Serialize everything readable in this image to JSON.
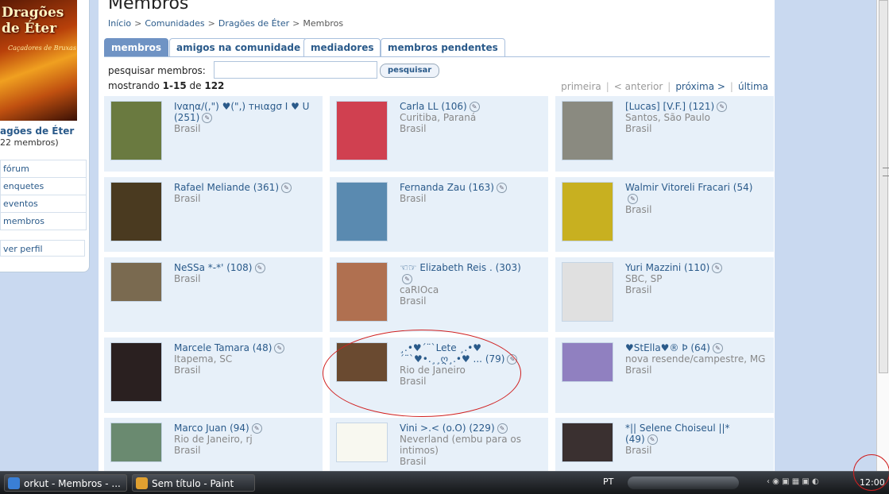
{
  "sidebar": {
    "community_name": "agões de Éter",
    "member_count": "22 membros)",
    "image_title": "Dragões de Éter",
    "image_subtitle": "Caçadores de Bruxas",
    "menu": [
      "fórum",
      "enquetes",
      "eventos",
      "membros"
    ],
    "profile_link": "ver perfil"
  },
  "page": {
    "title": "Membros",
    "breadcrumb": [
      "Início",
      "Comunidades",
      "Dragões de Éter",
      "Membros"
    ]
  },
  "tabs": [
    "membros",
    "amigos na comunidade",
    "mediadores",
    "membros pendentes"
  ],
  "search": {
    "label": "pesquisar membros:",
    "value": "",
    "button": "pesquisar"
  },
  "showing": {
    "prefix": "mostrando",
    "range": "1-15",
    "of": "de",
    "total": "122"
  },
  "pager": {
    "first": "primeira",
    "prev": "< anterior",
    "next": "próxima >",
    "last": "última"
  },
  "members": [
    {
      "name": "Ιvαηα/(,\") ♥(\",) тнιαgσ I ♥ U",
      "count": "(251)",
      "city": "",
      "country": "Brasil",
      "photo": "#6a7a40"
    },
    {
      "name": "Carla LL",
      "count": "(106)",
      "city": "Curitiba, Paraná",
      "country": "Brasil",
      "photo": "#d04050"
    },
    {
      "name": "[Lucas] [V.F.]",
      "count": "(121)",
      "city": "Santos, São Paulo",
      "country": "Brasil",
      "photo": "#8a8a80"
    },
    {
      "name": "Rafael Meliande",
      "count": "(361)",
      "city": "",
      "country": "Brasil",
      "photo": "#4a3a20"
    },
    {
      "name": "Fernanda Zau",
      "count": "(163)",
      "city": "",
      "country": "Brasil",
      "photo": "#5a8ab0"
    },
    {
      "name": "Walmir Vitoreli Fracari",
      "count": "(54)",
      "city": "",
      "country": "Brasil",
      "photo": "#c8b020"
    },
    {
      "name": "NeSSa *-*'",
      "count": "(108)",
      "city": "",
      "country": "Brasil",
      "photo": "#7a6a50"
    },
    {
      "name": "☜☞ Elizabeth Reis .",
      "count": "(303)",
      "city": "caRIOca",
      "country": "Brasil",
      "photo": "#b07050"
    },
    {
      "name": "Yuri Mazzini",
      "count": "(110)",
      "city": "SBC, SP",
      "country": "Brasil",
      "photo": "#e0e0e0"
    },
    {
      "name": "Marcele Tamara",
      "count": "(48)",
      "city": "Itapema, SC",
      "country": "Brasil",
      "photo": "#2a2020"
    },
    {
      "name": "¸.•♥´¨`Lete ¸.•♥´¨`♥•.¸¸ღ¸.•♥ ...",
      "count": "(79)",
      "city": "Rio de Janeiro",
      "country": "Brasil",
      "photo": "#6a4a30"
    },
    {
      "name": "♥StElla♥® Þ",
      "count": "(64)",
      "city": "nova resende/campestre, MG",
      "country": "Brasil",
      "photo": "#9080c0"
    },
    {
      "name": "Marco Juan",
      "count": "(94)",
      "city": "Rio de Janeiro, rj",
      "country": "Brasil",
      "photo": "#6a8a70"
    },
    {
      "name": "Vini >.< (o.O)",
      "count": "(229)",
      "city": "Neverland (embu para os intimos)",
      "country": "Brasil",
      "photo": "#f8f8f0"
    },
    {
      "name": "*|| Selene Choiseul ||*",
      "count": "(49)",
      "city": "",
      "country": "Brasil",
      "photo": "#3a3030"
    }
  ],
  "taskbar": {
    "buttons": [
      "orkut - Membros - ...",
      "Sem título - Paint"
    ],
    "language": "PT",
    "clock": "12:00"
  }
}
